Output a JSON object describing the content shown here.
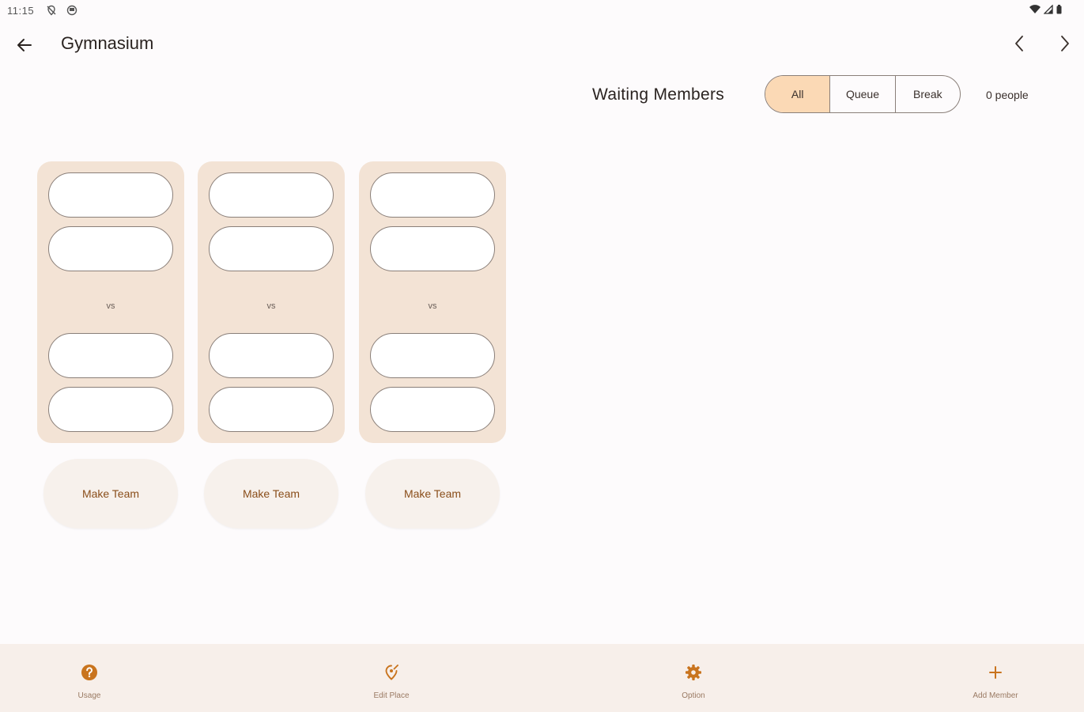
{
  "status_bar": {
    "time": "11:15"
  },
  "app_bar": {
    "title": "Gymnasium"
  },
  "waiting": {
    "label": "Waiting Members",
    "filters": [
      {
        "label": "All",
        "selected": true
      },
      {
        "label": "Queue",
        "selected": false
      },
      {
        "label": "Break",
        "selected": false
      }
    ],
    "count": "0 people"
  },
  "courts": [
    {
      "vs_label": "vs",
      "make_team_label": "Make Team"
    },
    {
      "vs_label": "vs",
      "make_team_label": "Make Team"
    },
    {
      "vs_label": "vs",
      "make_team_label": "Make Team"
    }
  ],
  "bottom_nav": [
    {
      "label": "Usage",
      "icon": "help-circle-icon"
    },
    {
      "label": "Edit Place",
      "icon": "edit-place-icon"
    },
    {
      "label": "Option",
      "icon": "gear-icon"
    },
    {
      "label": "Add Member",
      "icon": "plus-icon"
    }
  ],
  "colors": {
    "accent": "#c9741e",
    "segment_selected": "#fbd9b5",
    "court_bg": "#f3e3d5",
    "bottom_bar": "#f7efea"
  }
}
